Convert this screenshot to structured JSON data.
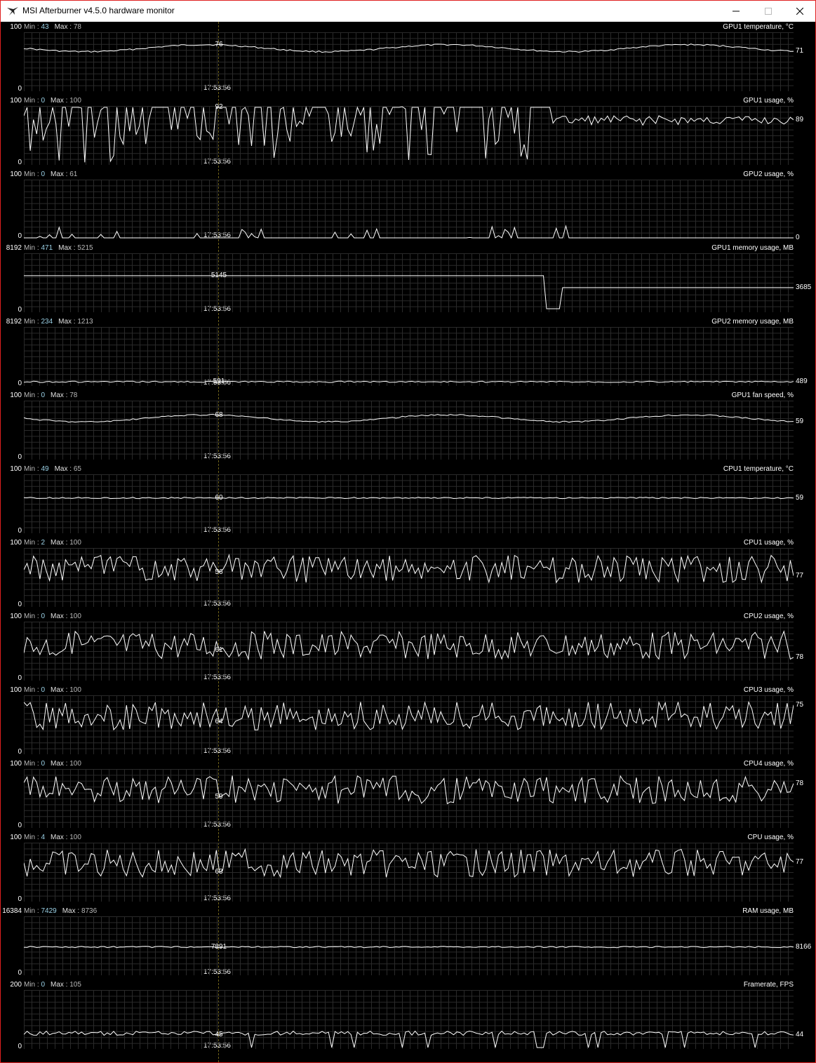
{
  "window": {
    "title": "MSI Afterburner v4.5.0 hardware monitor",
    "border_color": "#e02020"
  },
  "cursor": {
    "time": "17:53:56"
  },
  "min_label": "Min : ",
  "max_label": "Max : ",
  "panels": [
    {
      "title": "GPU1 temperature, °C",
      "min": "43",
      "max": "78",
      "ymax": "100",
      "ymin": "0",
      "cursor_value": "76",
      "current": "71"
    },
    {
      "title": "GPU1 usage, %",
      "min": "0",
      "max": "100",
      "ymax": "100",
      "ymin": "0",
      "cursor_value": "92",
      "current": "89"
    },
    {
      "title": "GPU2 usage, %",
      "min": "0",
      "max": "61",
      "ymax": "100",
      "ymin": "0",
      "cursor_value": "",
      "current": "0"
    },
    {
      "title": "GPU1 memory usage, MB",
      "min": "471",
      "max": "5215",
      "ymax": "8192",
      "ymin": "0",
      "cursor_value": "5145",
      "current": "3685"
    },
    {
      "title": "GPU2 memory usage, MB",
      "min": "234",
      "max": "1213",
      "ymax": "8192",
      "ymin": "0",
      "cursor_value": "591",
      "current": "489"
    },
    {
      "title": "GPU1 fan speed, %",
      "min": "0",
      "max": "78",
      "ymax": "100",
      "ymin": "0",
      "cursor_value": "68",
      "current": "59"
    },
    {
      "title": "CPU1 temperature, °C",
      "min": "49",
      "max": "65",
      "ymax": "100",
      "ymin": "0",
      "cursor_value": "60",
      "current": "59"
    },
    {
      "title": "CPU1 usage, %",
      "min": "2",
      "max": "100",
      "ymax": "100",
      "ymin": "0",
      "cursor_value": "56",
      "current": "77"
    },
    {
      "title": "CPU2 usage, %",
      "min": "0",
      "max": "100",
      "ymax": "100",
      "ymin": "0",
      "cursor_value": "61",
      "current": "78"
    },
    {
      "title": "CPU3 usage, %",
      "min": "0",
      "max": "100",
      "ymax": "100",
      "ymin": "0",
      "cursor_value": "64",
      "current": "75"
    },
    {
      "title": "CPU4 usage, %",
      "min": "0",
      "max": "100",
      "ymax": "100",
      "ymin": "0",
      "cursor_value": "59",
      "current": "78"
    },
    {
      "title": "CPU usage, %",
      "min": "4",
      "max": "100",
      "ymax": "100",
      "ymin": "0",
      "cursor_value": "63",
      "current": "77"
    },
    {
      "title": "RAM usage, MB",
      "min": "7429",
      "max": "8736",
      "ymax": "16384",
      "ymin": "0",
      "cursor_value": "7891",
      "current": "8166"
    },
    {
      "title": "Framerate, FPS",
      "min": "0",
      "max": "105",
      "ymax": "200",
      "ymin": "0",
      "cursor_value": "45",
      "current": "44"
    }
  ]
}
